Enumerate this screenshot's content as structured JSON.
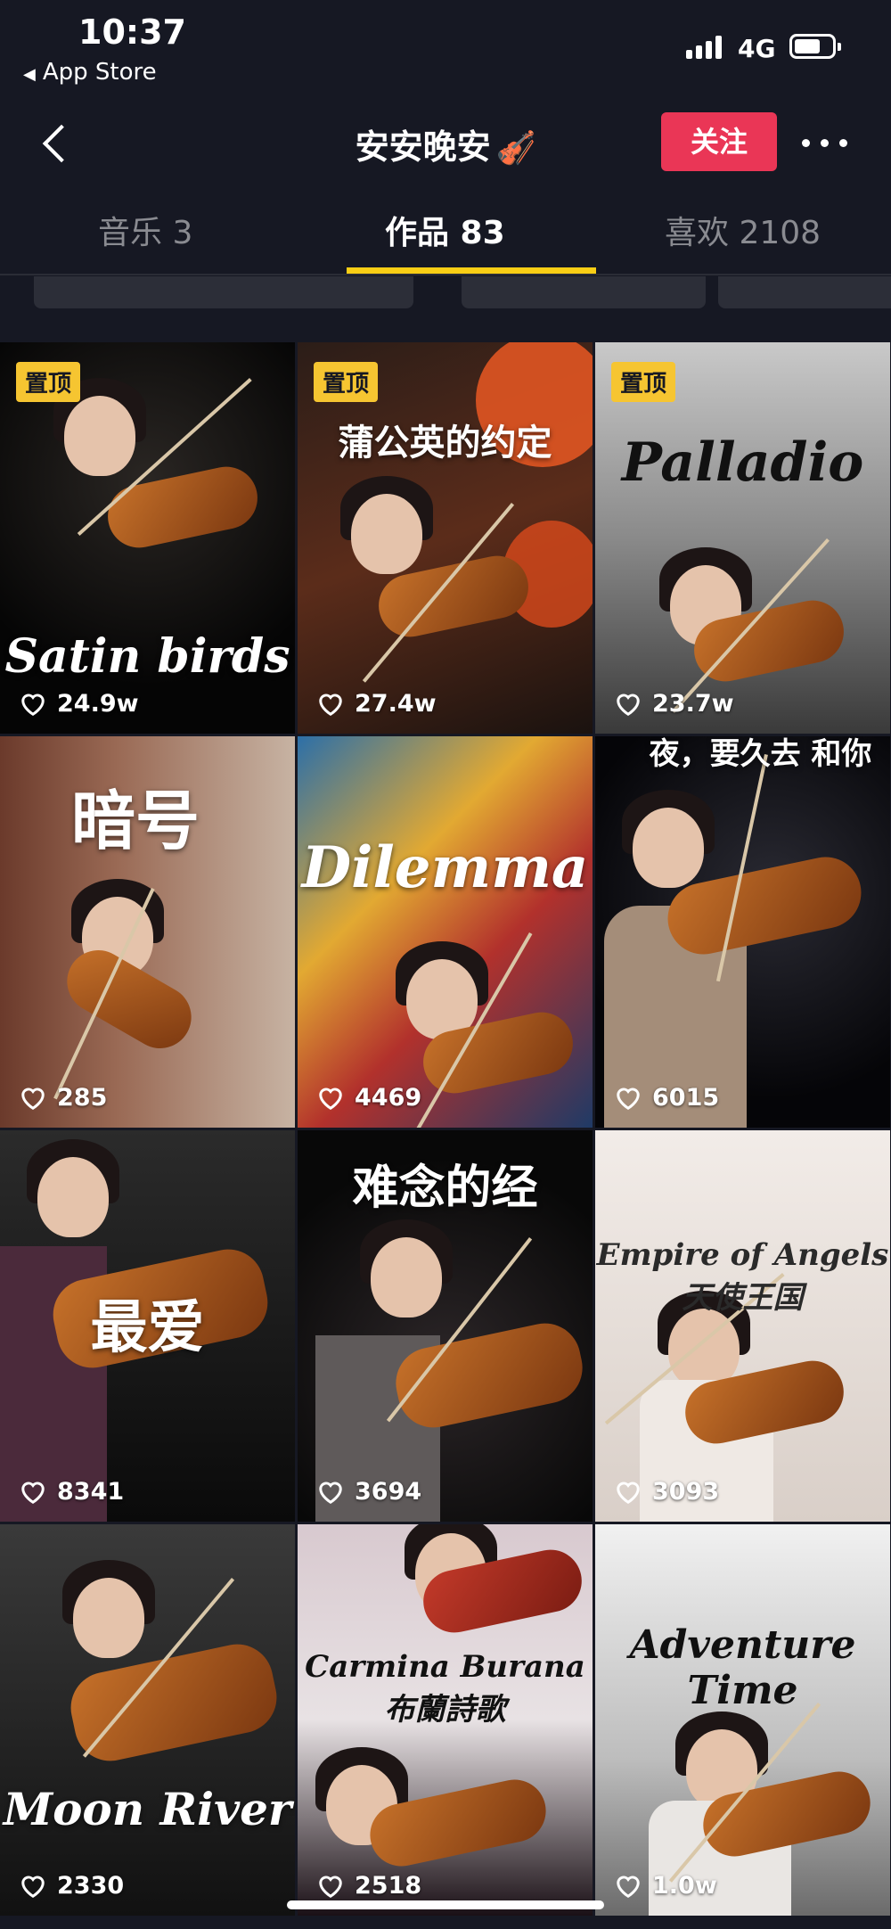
{
  "status_bar": {
    "time": "10:37",
    "back_app": "App Store",
    "network": "4G",
    "battery_level": 0.7
  },
  "header": {
    "title": "安安晚安",
    "title_emoji": "🎻",
    "follow_label": "关注"
  },
  "tabs": [
    {
      "label": "音乐 3",
      "active": false
    },
    {
      "label": "作品 83",
      "active": true
    },
    {
      "label": "喜欢 2108",
      "active": false
    }
  ],
  "pinned_label": "置顶",
  "colors": {
    "background": "#161823",
    "follow_button": "#ea3656",
    "tab_indicator": "#face15",
    "pin_badge": "#f6c531"
  },
  "videos": [
    {
      "caption": "Satin birds",
      "likes": "24.9w",
      "pinned": true
    },
    {
      "caption": "蒲公英的约定",
      "likes": "27.4w",
      "pinned": true
    },
    {
      "caption": "Palladio",
      "likes": "23.7w",
      "pinned": true
    },
    {
      "caption": "暗号",
      "likes": "285",
      "pinned": false
    },
    {
      "caption": "Dilemma",
      "likes": "4469",
      "pinned": false
    },
    {
      "caption": "夜，要久去 和你",
      "likes": "6015",
      "pinned": false
    },
    {
      "caption": "最爱",
      "likes": "8341",
      "pinned": false
    },
    {
      "caption": "难念的经",
      "likes": "3694",
      "pinned": false
    },
    {
      "caption": "Empire of Angels 天使王国",
      "likes": "3093",
      "pinned": false
    },
    {
      "caption": "Moon River",
      "likes": "2330",
      "pinned": false
    },
    {
      "caption": "Carmina Burana 布蘭詩歌",
      "likes": "2518",
      "pinned": false
    },
    {
      "caption": "Adventure Time",
      "likes": "1.0w",
      "pinned": false
    }
  ]
}
